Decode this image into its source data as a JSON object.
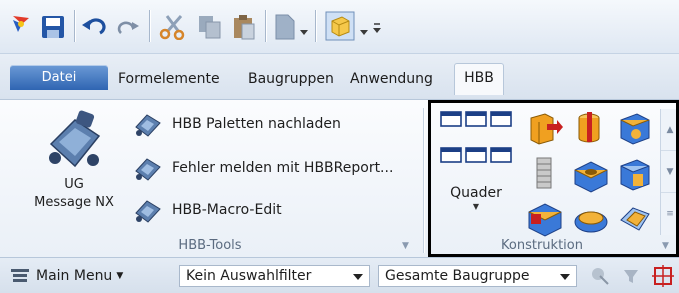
{
  "tabs": {
    "file": "Datei",
    "items": [
      "Formelemente",
      "Baugruppen",
      "Anwendung",
      "HBB"
    ]
  },
  "hbb_tools": {
    "big_button": {
      "line1": "UG",
      "line2": "Message NX"
    },
    "buttons": [
      "HBB Paletten nachladen",
      "Fehler melden mit HBBReport...",
      "HBB-Macro-Edit"
    ],
    "group_label": "HBB-Tools"
  },
  "konstruktion": {
    "quader_label": "Quader",
    "group_label": "Konstruktion"
  },
  "bottom_bar": {
    "main_menu": "Main Menu",
    "filter": "Kein Auswahlfilter",
    "scope": "Gesamte Baugruppe"
  },
  "colors": {
    "file_tab": "#2f65b2",
    "ribbon_bg": "#f3f6fb",
    "highlight_box": "#000000",
    "feature_orange": "#f0a020",
    "feature_blue": "#3a79d8"
  },
  "icons": [
    "app-logo-icon",
    "save-icon",
    "undo-icon",
    "redo-icon",
    "cut-icon",
    "copy-icon",
    "paste-icon",
    "new-document-icon",
    "view-cube-icon",
    "customize-qat-icon"
  ]
}
